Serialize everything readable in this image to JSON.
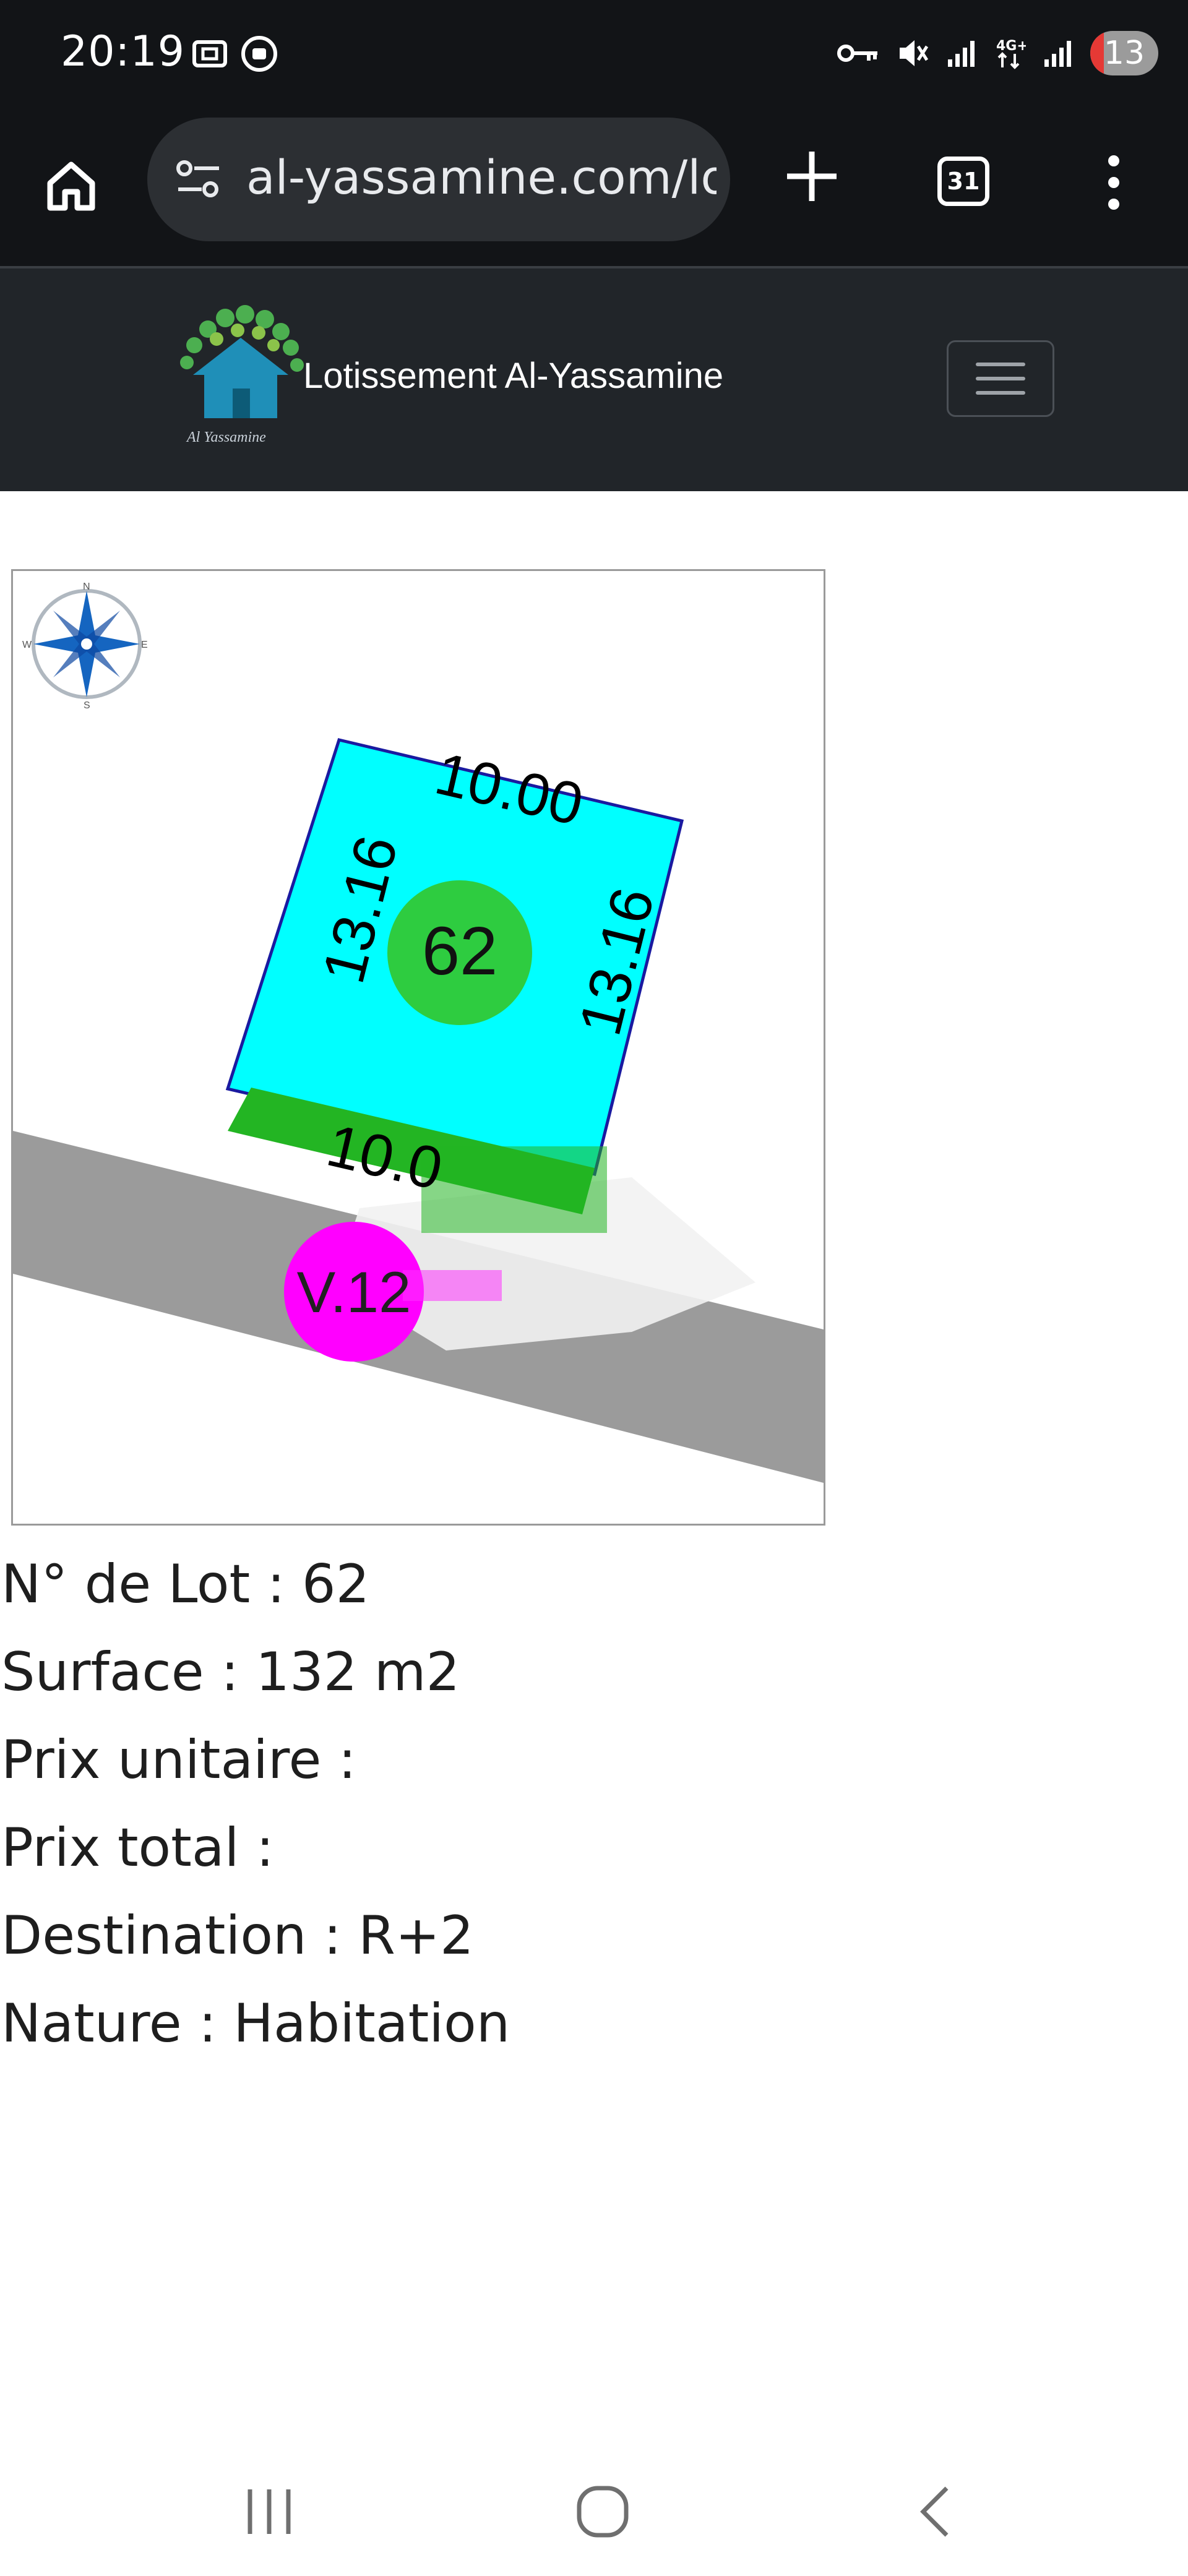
{
  "status_bar": {
    "time": "20:19",
    "battery": "13",
    "icons": [
      "screen-record-icon",
      "media-icon",
      "vpn-key-icon",
      "mute-icon",
      "signal-icon",
      "4g-icon",
      "signal-icon"
    ]
  },
  "browser": {
    "url": "al-yassamine.com/lo",
    "tab_count": "31",
    "icons": [
      "home-icon",
      "site-settings-icon",
      "new-tab-icon",
      "more-icon"
    ]
  },
  "site": {
    "brand": "Lotissement Al-Yassamine",
    "logo_caption": "Al Yassamine",
    "colors": {
      "nav_bg": "#212529"
    }
  },
  "plan": {
    "lot_number": "62",
    "top_side": "10.00",
    "left_side": "13.16",
    "right_side": "13.16",
    "bottom_side": "10.0",
    "road_label": "V.12",
    "compass": {
      "n": "N",
      "s": "S",
      "e": "E",
      "w": "W"
    },
    "colors": {
      "lot_fill": "#00ffff",
      "setback_fill": "#23b523",
      "lot_badge": "#2ecc40",
      "road": "#9b9b9b",
      "road_badge": "#ff00ff"
    }
  },
  "details": [
    {
      "label": "N° de Lot",
      "value": "62"
    },
    {
      "label": "Surface",
      "value": "132 m2"
    },
    {
      "label": "Prix unitaire",
      "value": ""
    },
    {
      "label": "Prix total",
      "value": ""
    },
    {
      "label": "Destination",
      "value": "R+2"
    },
    {
      "label": "Nature",
      "value": "Habitation"
    }
  ]
}
